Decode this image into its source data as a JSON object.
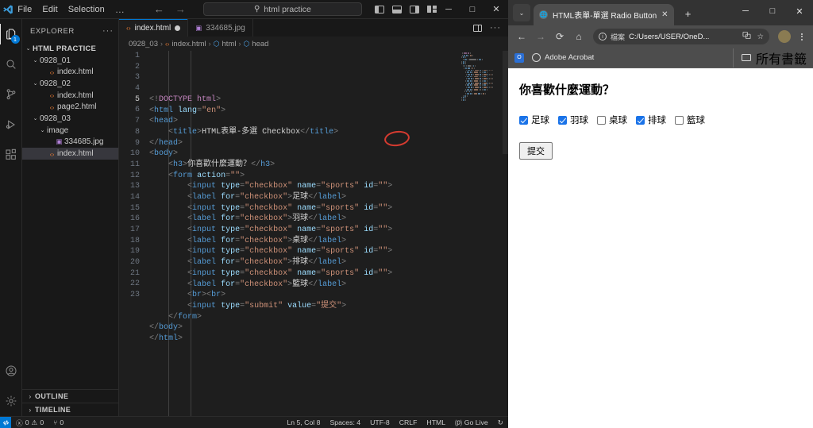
{
  "vscode": {
    "titlebar": {
      "menus": [
        "File",
        "Edit",
        "Selection",
        "…"
      ],
      "back_icon": "←",
      "forward_icon": "→",
      "search_placeholder": "html practice",
      "search_icon": "search-icon",
      "layout_icons": [
        "toggle-primary-sidebar",
        "toggle-panel",
        "toggle-secondary-sidebar",
        "customize-layout"
      ],
      "minimize": "─",
      "maximize": "□",
      "close": "✕"
    },
    "activitybar": {
      "items": [
        {
          "name": "explorer",
          "glyph": "⧉",
          "badge": "1",
          "active": true
        },
        {
          "name": "search",
          "glyph": "⚲",
          "badge": "",
          "active": false
        },
        {
          "name": "source-control",
          "glyph": "⎇",
          "badge": "",
          "active": false
        },
        {
          "name": "run-and-debug",
          "glyph": "▷",
          "badge": "",
          "active": false
        },
        {
          "name": "extensions",
          "glyph": "⊞",
          "badge": "",
          "active": false
        }
      ],
      "bottom": [
        {
          "name": "accounts",
          "glyph": "☺"
        },
        {
          "name": "manage-settings",
          "glyph": "⚙"
        }
      ]
    },
    "sidebar": {
      "title": "EXPLORER",
      "more_actions": "···",
      "tree": [
        {
          "label": "HTML PRACTICE",
          "depth": 0,
          "kind": "root",
          "chev": "⌄",
          "selected": false
        },
        {
          "label": "0928_01",
          "depth": 1,
          "kind": "folder",
          "chev": "⌄",
          "selected": false
        },
        {
          "label": "index.html",
          "depth": 2,
          "kind": "html",
          "chev": "",
          "selected": false
        },
        {
          "label": "0928_02",
          "depth": 1,
          "kind": "folder",
          "chev": "⌄",
          "selected": false
        },
        {
          "label": "index.html",
          "depth": 2,
          "kind": "html",
          "chev": "",
          "selected": false
        },
        {
          "label": "page2.html",
          "depth": 2,
          "kind": "html",
          "chev": "",
          "selected": false
        },
        {
          "label": "0928_03",
          "depth": 1,
          "kind": "folder",
          "chev": "⌄",
          "selected": false
        },
        {
          "label": "image",
          "depth": 2,
          "kind": "folder",
          "chev": "⌄",
          "selected": false
        },
        {
          "label": "334685.jpg",
          "depth": 3,
          "kind": "img",
          "chev": "",
          "selected": false
        },
        {
          "label": "index.html",
          "depth": 2,
          "kind": "html",
          "chev": "",
          "selected": true
        }
      ],
      "panels": [
        {
          "label": "OUTLINE",
          "chev": "›"
        },
        {
          "label": "TIMELINE",
          "chev": "›"
        }
      ]
    },
    "tabs": [
      {
        "label": "index.html",
        "kind": "html",
        "active": true,
        "dirty": true
      },
      {
        "label": "334685.jpg",
        "kind": "img",
        "active": false,
        "dirty": false
      }
    ],
    "tab_actions": [
      "split-editor",
      "···"
    ],
    "breadcrumb": [
      {
        "label": "0928_03",
        "icon": ""
      },
      {
        "label": "index.html",
        "icon": "html"
      },
      {
        "label": "html",
        "icon": "tag"
      },
      {
        "label": "head",
        "icon": "tag"
      }
    ],
    "breadcrumb_sep": "›",
    "code": {
      "line_count": 23,
      "current_line": 5,
      "lines": [
        [
          [
            "punc",
            "<!"
          ],
          [
            "dtname",
            "DOCTYPE"
          ],
          [
            "txt",
            " "
          ],
          [
            "dtname",
            "html"
          ],
          [
            "punc",
            ">"
          ]
        ],
        [
          [
            "punc",
            "<"
          ],
          [
            "tag",
            "html"
          ],
          [
            "txt",
            " "
          ],
          [
            "attr",
            "lang"
          ],
          [
            "punc",
            "="
          ],
          [
            "str",
            "\"en\""
          ],
          [
            "punc",
            ">"
          ]
        ],
        [
          [
            "punc",
            "<"
          ],
          [
            "tag",
            "head"
          ],
          [
            "punc",
            ">"
          ]
        ],
        [
          [
            "txt",
            "    "
          ],
          [
            "punc",
            "<"
          ],
          [
            "tag",
            "title"
          ],
          [
            "punc",
            ">"
          ],
          [
            "txt",
            "HTML表單-多選 Checkbox"
          ],
          [
            "punc",
            "</"
          ],
          [
            "tag",
            "title"
          ],
          [
            "punc",
            ">"
          ]
        ],
        [
          [
            "punc",
            "</"
          ],
          [
            "tag",
            "head"
          ],
          [
            "punc",
            ">"
          ]
        ],
        [
          [
            "punc",
            "<"
          ],
          [
            "tag",
            "body"
          ],
          [
            "punc",
            ">"
          ]
        ],
        [
          [
            "txt",
            "    "
          ],
          [
            "punc",
            "<"
          ],
          [
            "tag",
            "h3"
          ],
          [
            "punc",
            ">"
          ],
          [
            "txt",
            "你喜歡什麼運動？"
          ],
          [
            "punc",
            "</"
          ],
          [
            "tag",
            "h3"
          ],
          [
            "punc",
            ">"
          ]
        ],
        [
          [
            "txt",
            "    "
          ],
          [
            "punc",
            "<"
          ],
          [
            "tag",
            "form"
          ],
          [
            "txt",
            " "
          ],
          [
            "attr",
            "action"
          ],
          [
            "punc",
            "="
          ],
          [
            "str",
            "\"\""
          ],
          [
            "punc",
            ">"
          ]
        ],
        [
          [
            "txt",
            "        "
          ],
          [
            "punc",
            "<"
          ],
          [
            "tag",
            "input"
          ],
          [
            "txt",
            " "
          ],
          [
            "attr",
            "type"
          ],
          [
            "punc",
            "="
          ],
          [
            "str",
            "\"checkbox\""
          ],
          [
            "txt",
            " "
          ],
          [
            "attr",
            "name"
          ],
          [
            "punc",
            "="
          ],
          [
            "str",
            "\"sports\""
          ],
          [
            "txt",
            " "
          ],
          [
            "attr",
            "id"
          ],
          [
            "punc",
            "="
          ],
          [
            "str",
            "\"\""
          ],
          [
            "punc",
            ">"
          ]
        ],
        [
          [
            "txt",
            "        "
          ],
          [
            "punc",
            "<"
          ],
          [
            "tag",
            "label"
          ],
          [
            "txt",
            " "
          ],
          [
            "attr",
            "for"
          ],
          [
            "punc",
            "="
          ],
          [
            "str",
            "\"checkbox\""
          ],
          [
            "punc",
            ">"
          ],
          [
            "txt",
            "足球"
          ],
          [
            "punc",
            "</"
          ],
          [
            "tag",
            "label"
          ],
          [
            "punc",
            ">"
          ]
        ],
        [
          [
            "txt",
            "        "
          ],
          [
            "punc",
            "<"
          ],
          [
            "tag",
            "input"
          ],
          [
            "txt",
            " "
          ],
          [
            "attr",
            "type"
          ],
          [
            "punc",
            "="
          ],
          [
            "str",
            "\"checkbox\""
          ],
          [
            "txt",
            " "
          ],
          [
            "attr",
            "name"
          ],
          [
            "punc",
            "="
          ],
          [
            "str",
            "\"sports\""
          ],
          [
            "txt",
            " "
          ],
          [
            "attr",
            "id"
          ],
          [
            "punc",
            "="
          ],
          [
            "str",
            "\"\""
          ],
          [
            "punc",
            ">"
          ]
        ],
        [
          [
            "txt",
            "        "
          ],
          [
            "punc",
            "<"
          ],
          [
            "tag",
            "label"
          ],
          [
            "txt",
            " "
          ],
          [
            "attr",
            "for"
          ],
          [
            "punc",
            "="
          ],
          [
            "str",
            "\"checkbox\""
          ],
          [
            "punc",
            ">"
          ],
          [
            "txt",
            "羽球"
          ],
          [
            "punc",
            "</"
          ],
          [
            "tag",
            "label"
          ],
          [
            "punc",
            ">"
          ]
        ],
        [
          [
            "txt",
            "        "
          ],
          [
            "punc",
            "<"
          ],
          [
            "tag",
            "input"
          ],
          [
            "txt",
            " "
          ],
          [
            "attr",
            "type"
          ],
          [
            "punc",
            "="
          ],
          [
            "str",
            "\"checkbox\""
          ],
          [
            "txt",
            " "
          ],
          [
            "attr",
            "name"
          ],
          [
            "punc",
            "="
          ],
          [
            "str",
            "\"sports\""
          ],
          [
            "txt",
            " "
          ],
          [
            "attr",
            "id"
          ],
          [
            "punc",
            "="
          ],
          [
            "str",
            "\"\""
          ],
          [
            "punc",
            ">"
          ]
        ],
        [
          [
            "txt",
            "        "
          ],
          [
            "punc",
            "<"
          ],
          [
            "tag",
            "label"
          ],
          [
            "txt",
            " "
          ],
          [
            "attr",
            "for"
          ],
          [
            "punc",
            "="
          ],
          [
            "str",
            "\"checkbox\""
          ],
          [
            "punc",
            ">"
          ],
          [
            "txt",
            "桌球"
          ],
          [
            "punc",
            "</"
          ],
          [
            "tag",
            "label"
          ],
          [
            "punc",
            ">"
          ]
        ],
        [
          [
            "txt",
            "        "
          ],
          [
            "punc",
            "<"
          ],
          [
            "tag",
            "input"
          ],
          [
            "txt",
            " "
          ],
          [
            "attr",
            "type"
          ],
          [
            "punc",
            "="
          ],
          [
            "str",
            "\"checkbox\""
          ],
          [
            "txt",
            " "
          ],
          [
            "attr",
            "name"
          ],
          [
            "punc",
            "="
          ],
          [
            "str",
            "\"sports\""
          ],
          [
            "txt",
            " "
          ],
          [
            "attr",
            "id"
          ],
          [
            "punc",
            "="
          ],
          [
            "str",
            "\"\""
          ],
          [
            "punc",
            ">"
          ]
        ],
        [
          [
            "txt",
            "        "
          ],
          [
            "punc",
            "<"
          ],
          [
            "tag",
            "label"
          ],
          [
            "txt",
            " "
          ],
          [
            "attr",
            "for"
          ],
          [
            "punc",
            "="
          ],
          [
            "str",
            "\"checkbox\""
          ],
          [
            "punc",
            ">"
          ],
          [
            "txt",
            "排球"
          ],
          [
            "punc",
            "</"
          ],
          [
            "tag",
            "label"
          ],
          [
            "punc",
            ">"
          ]
        ],
        [
          [
            "txt",
            "        "
          ],
          [
            "punc",
            "<"
          ],
          [
            "tag",
            "input"
          ],
          [
            "txt",
            " "
          ],
          [
            "attr",
            "type"
          ],
          [
            "punc",
            "="
          ],
          [
            "str",
            "\"checkbox\""
          ],
          [
            "txt",
            " "
          ],
          [
            "attr",
            "name"
          ],
          [
            "punc",
            "="
          ],
          [
            "str",
            "\"sports\""
          ],
          [
            "txt",
            " "
          ],
          [
            "attr",
            "id"
          ],
          [
            "punc",
            "="
          ],
          [
            "str",
            "\"\""
          ],
          [
            "punc",
            ">"
          ]
        ],
        [
          [
            "txt",
            "        "
          ],
          [
            "punc",
            "<"
          ],
          [
            "tag",
            "label"
          ],
          [
            "txt",
            " "
          ],
          [
            "attr",
            "for"
          ],
          [
            "punc",
            "="
          ],
          [
            "str",
            "\"checkbox\""
          ],
          [
            "punc",
            ">"
          ],
          [
            "txt",
            "籃球"
          ],
          [
            "punc",
            "</"
          ],
          [
            "tag",
            "label"
          ],
          [
            "punc",
            ">"
          ]
        ],
        [
          [
            "txt",
            "        "
          ],
          [
            "punc",
            "<"
          ],
          [
            "tag",
            "br"
          ],
          [
            "punc",
            "><"
          ],
          [
            "tag",
            "br"
          ],
          [
            "punc",
            ">"
          ]
        ],
        [
          [
            "txt",
            "        "
          ],
          [
            "punc",
            "<"
          ],
          [
            "tag",
            "input"
          ],
          [
            "txt",
            " "
          ],
          [
            "attr",
            "type"
          ],
          [
            "punc",
            "="
          ],
          [
            "str",
            "\"submit\""
          ],
          [
            "txt",
            " "
          ],
          [
            "attr",
            "value"
          ],
          [
            "punc",
            "="
          ],
          [
            "str",
            "\"提交\""
          ],
          [
            "punc",
            ">"
          ]
        ],
        [
          [
            "txt",
            "    "
          ],
          [
            "punc",
            "</"
          ],
          [
            "tag",
            "form"
          ],
          [
            "punc",
            ">"
          ]
        ],
        [
          [
            "punc",
            "</"
          ],
          [
            "tag",
            "body"
          ],
          [
            "punc",
            ">"
          ]
        ],
        [
          [
            "punc",
            "</"
          ],
          [
            "tag",
            "html"
          ],
          [
            "punc",
            ">"
          ]
        ]
      ],
      "annotation": {
        "shape": "ellipse",
        "color": "#d63b30",
        "target_text": "多選"
      }
    },
    "statusbar": {
      "remote_icon": "remote-window-icon",
      "errors": "0",
      "warnings": "0",
      "ports": "0",
      "error_icon": "ⓧ",
      "warning_icon": "⚠",
      "ports_icon": "⑂",
      "cursor": "Ln 5, Col 8",
      "indentation": "Spaces: 4",
      "encoding": "UTF-8",
      "eol": "CRLF",
      "language": "HTML",
      "golive": "Go Live",
      "golive_icon": "⒫",
      "bell_icon": "↻"
    }
  },
  "browser": {
    "tab_search_icon": "⌄",
    "tabs": [
      {
        "title": "HTML表單-單選 Radio Button",
        "active": true,
        "close": "✕"
      }
    ],
    "new_tab": "+",
    "window": {
      "minimize": "─",
      "maximize": "□",
      "close": "✕"
    },
    "toolbar": {
      "back": "←",
      "forward": "→",
      "reload": "⟳",
      "home": "⌂",
      "info_icon": "ⓘ",
      "file_badge": "檔案",
      "url": "C:/Users/USER/OneD...",
      "translate_icon": "translate-icon",
      "bookmark_icon": "☆",
      "profile_icon": "avatar-icon",
      "menu_icon": "kebab-menu-icon"
    },
    "bookmarks": {
      "items": [
        {
          "label": "",
          "icon": "office-icon"
        },
        {
          "label": "Adobe Acrobat",
          "icon": "globe-icon"
        }
      ],
      "all_bookmarks": "所有書籤",
      "folder_icon": "folder-icon"
    },
    "page": {
      "heading": "你喜歡什麼運動？",
      "checkboxes": [
        {
          "label": "足球",
          "checked": true
        },
        {
          "label": "羽球",
          "checked": true
        },
        {
          "label": "桌球",
          "checked": false
        },
        {
          "label": "排球",
          "checked": true
        },
        {
          "label": "籃球",
          "checked": false
        }
      ],
      "submit_label": "提交"
    }
  }
}
